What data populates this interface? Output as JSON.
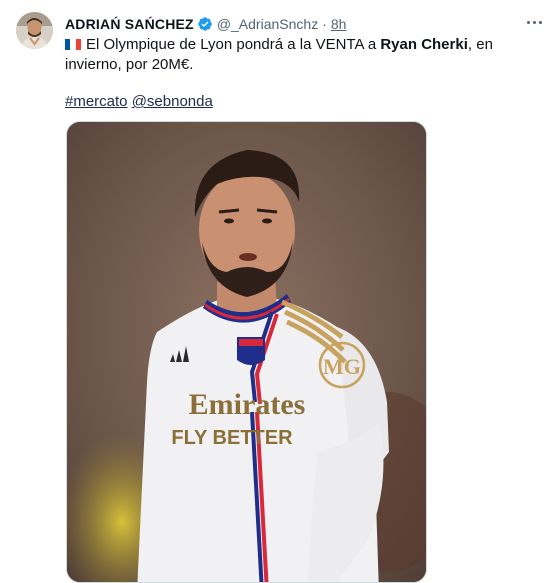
{
  "author": {
    "display_name": "ADRIAŃ SAŃCHEZ",
    "handle": "@_AdrianSnchz",
    "separator": "·",
    "time": "8h",
    "verified_color": "#1d9bf0"
  },
  "tweet": {
    "flag_icon": "france-flag-icon",
    "text_before": "El Olympique de Lyon pondrá a la VENTA a ",
    "text_bold": "Ryan Cherki",
    "text_after": ", en invierno, por 20M€.",
    "hashtag": "#mercato",
    "mention": "@sebnonda"
  },
  "media": {
    "sponsor_line1": "Emirates",
    "sponsor_line2": "FLY BETTER",
    "badge": "MG"
  },
  "colors": {
    "text": "#0f1419",
    "muted": "#536471",
    "link": "#1d2b4f"
  }
}
